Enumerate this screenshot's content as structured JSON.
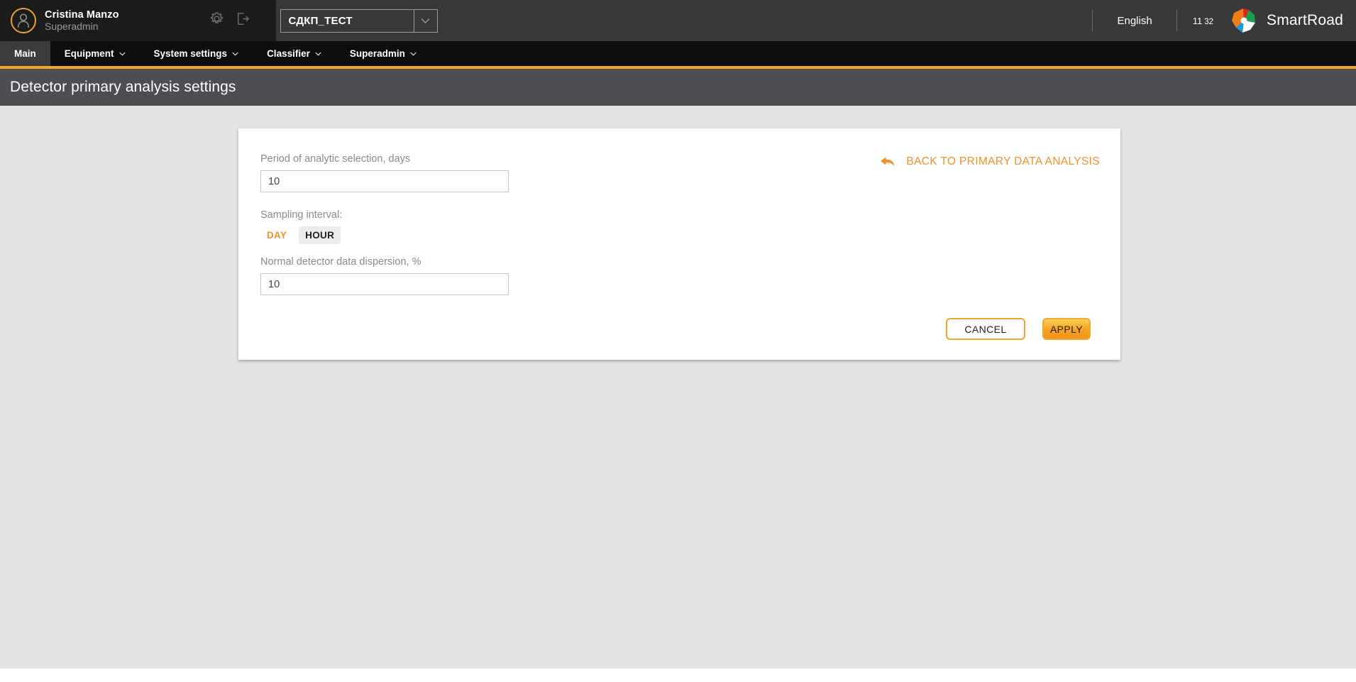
{
  "header": {
    "user_name": "Cristina Manzo",
    "user_role": "Superadmin",
    "avatar_icon": "user-avatar-icon",
    "settings_icon": "gear-icon",
    "logout_icon": "logout-icon",
    "project": {
      "value": "СДКП_ТЕСТ",
      "caret_icon": "chevron-down-icon"
    },
    "language": "English",
    "clock": {
      "hours": "11",
      "minutes": "32"
    },
    "brand": {
      "name": "SmartRoad",
      "logo_icon": "smartroad-pinwheel-logo"
    }
  },
  "nav": {
    "items": [
      {
        "label": "Main",
        "active": true,
        "has_caret": false
      },
      {
        "label": "Equipment",
        "active": false,
        "has_caret": true
      },
      {
        "label": "System settings",
        "active": false,
        "has_caret": true
      },
      {
        "label": "Classifier",
        "active": false,
        "has_caret": true
      },
      {
        "label": "Superadmin",
        "active": false,
        "has_caret": true
      }
    ]
  },
  "page": {
    "title": "Detector primary analysis settings"
  },
  "form": {
    "period_label": "Period of analytic selection, days",
    "period_value": "10",
    "sampling_label": "Sampling interval:",
    "sampling_options": [
      {
        "label": "DAY",
        "selected": false
      },
      {
        "label": "HOUR",
        "selected": true
      }
    ],
    "dispersion_label": "Normal detector data dispersion, %",
    "dispersion_value": "10"
  },
  "back_link": {
    "label": "BACK TO PRIMARY DATA ANALYSIS",
    "icon": "arrow-back-curved-icon"
  },
  "buttons": {
    "cancel": "CANCEL",
    "apply": "APPLY"
  },
  "colors": {
    "accent_orange": "#f0a82a",
    "link_orange": "#f0912a",
    "header_dark": "#383838",
    "header_user_bg": "#1b1b1b",
    "nav_bg": "#0d0d0d",
    "title_bar": "#4d4d52",
    "body_bg": "#e4e4e4"
  }
}
